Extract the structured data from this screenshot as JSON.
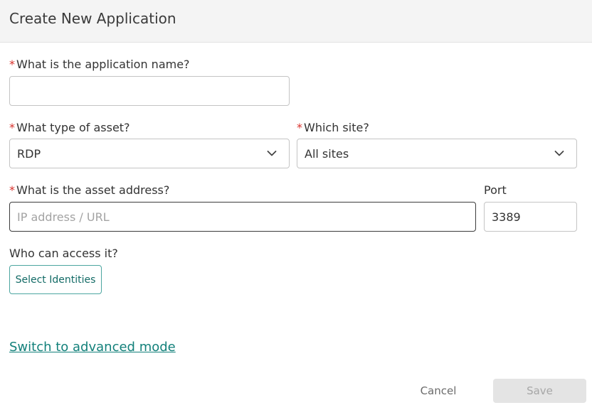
{
  "dialog": {
    "title": "Create New Application"
  },
  "form": {
    "required_marker": "*",
    "app_name": {
      "label": "What is the application name?",
      "value": ""
    },
    "asset_type": {
      "label": "What type of asset?",
      "selected": "RDP"
    },
    "site": {
      "label": "Which site?",
      "selected": "All sites"
    },
    "asset_address": {
      "label": "What is the asset address?",
      "placeholder": "IP address / URL",
      "value": ""
    },
    "port": {
      "label": "Port",
      "value": "3389"
    },
    "access": {
      "label": "Who can access it?",
      "button_label": "Select Identities"
    }
  },
  "footer": {
    "advanced_link": "Switch to advanced mode",
    "cancel_label": "Cancel",
    "save_label": "Save"
  },
  "icons": {
    "select_chevron": "chevron-down-icon"
  },
  "colors": {
    "accent": "#12807a",
    "required": "#d9322c",
    "header_bg": "#f4f4f4",
    "save_disabled_bg": "#e4e4e4"
  }
}
